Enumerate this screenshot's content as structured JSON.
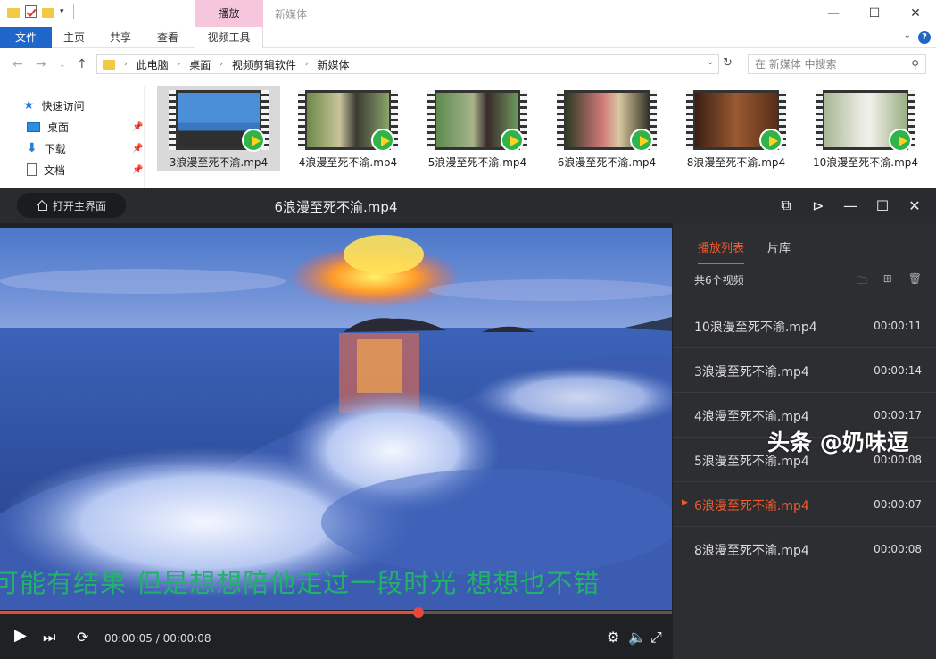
{
  "explorer": {
    "context_tab": "播放",
    "title": "新媒体",
    "ribbon_tabs": [
      "文件",
      "主页",
      "共享",
      "查看",
      "视频工具"
    ],
    "breadcrumb": [
      "此电脑",
      "桌面",
      "视频剪辑软件",
      "新媒体"
    ],
    "search_placeholder": "在 新媒体 中搜索",
    "nav_items": [
      "快速访问",
      "桌面",
      "下载",
      "文档"
    ],
    "files": [
      "3浪漫至死不渝.mp4",
      "4浪漫至死不渝.mp4",
      "5浪漫至死不渝.mp4",
      "6浪漫至死不渝.mp4",
      "8浪漫至死不渝.mp4",
      "10浪漫至死不渝.mp4"
    ],
    "selected_file_index": 0
  },
  "player": {
    "home_label": "打开主界面",
    "title": "6浪漫至死不渝.mp4",
    "subtitle": "可能有结果  但是想想陪他走过一段时光  想想也不错",
    "current_time": "00:00:05",
    "duration": "00:00:08",
    "time_separator": "/",
    "progress": 0.623,
    "sidebar": {
      "tab_playlist": "播放列表",
      "tab_library": "片库",
      "count_label": "共6个视频",
      "items": [
        {
          "name": "10浪漫至死不渝.mp4",
          "duration": "00:00:11",
          "active": false
        },
        {
          "name": "3浪漫至死不渝.mp4",
          "duration": "00:00:14",
          "active": false
        },
        {
          "name": "4浪漫至死不渝.mp4",
          "duration": "00:00:17",
          "active": false
        },
        {
          "name": "5浪漫至死不渝.mp4",
          "duration": "00:00:08",
          "active": false
        },
        {
          "name": "6浪漫至死不渝.mp4",
          "duration": "00:00:07",
          "active": true
        },
        {
          "name": "8浪漫至死不渝.mp4",
          "duration": "00:00:08",
          "active": false
        }
      ]
    },
    "accent_color": "#f15a2b",
    "subtitle_color": "#21b36a"
  },
  "watermark": "头条 @奶味逗"
}
